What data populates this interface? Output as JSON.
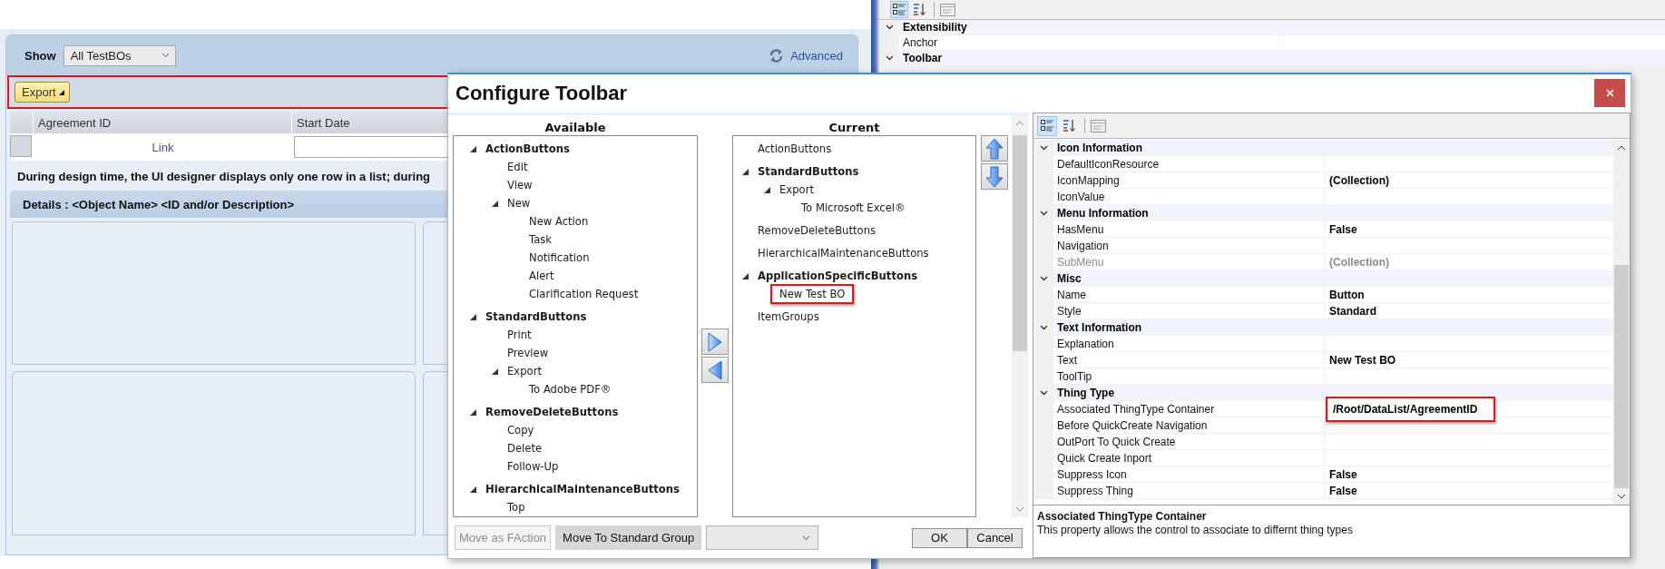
{
  "designer": {
    "filter": {
      "label": "Show",
      "value": "All TestBOs"
    },
    "advanced_link": "Advanced",
    "toolbar": {
      "highlighted": true,
      "buttons": [
        "Export"
      ]
    },
    "table": {
      "columns": [
        "Agreement ID",
        "Start Date"
      ],
      "link": "Link"
    },
    "note": "During design time, the UI designer displays only one row in a list; during",
    "details_title": "Details : <Object Name> <ID and/or Description>"
  },
  "background_properties": {
    "view_buttons": [
      {
        "kind": "categorized",
        "selected": true
      },
      {
        "kind": "alphabetical",
        "selected": false
      }
    ],
    "categories": [
      {
        "name": "Extensibility",
        "expanded": true,
        "rows": [
          {
            "name": "Anchor",
            "disabled": false
          }
        ]
      },
      {
        "name": "Toolbar",
        "expanded": true
      }
    ]
  },
  "dialog": {
    "title": "Configure Toolbar",
    "available": {
      "heading": "Available",
      "tree": [
        {
          "label": "ActionButtons",
          "expanded": true,
          "children": [
            {
              "label": "Edit"
            },
            {
              "label": "View"
            },
            {
              "label": "New",
              "expanded": true,
              "children": [
                {
                  "label": "New Action"
                },
                {
                  "label": "Task"
                },
                {
                  "label": "Notification"
                },
                {
                  "label": "Alert"
                },
                {
                  "label": "Clarification Request"
                }
              ]
            }
          ]
        },
        {
          "label": "StandardButtons",
          "expanded": true,
          "children": [
            {
              "label": "Print"
            },
            {
              "label": "Preview"
            },
            {
              "label": "Export",
              "expanded": true,
              "children": [
                {
                  "label": "To Adobe PDF®"
                }
              ]
            }
          ]
        },
        {
          "label": "RemoveDeleteButtons",
          "expanded": true,
          "children": [
            {
              "label": "Copy"
            },
            {
              "label": "Delete"
            },
            {
              "label": "Follow-Up"
            }
          ]
        },
        {
          "label": "HierarchicalMaintenanceButtons",
          "expanded": true,
          "children": [
            {
              "label": "Top"
            }
          ]
        }
      ]
    },
    "current": {
      "heading": "Current",
      "tree": [
        {
          "label": "ActionButtons"
        },
        {
          "label": "StandardButtons",
          "expanded": true,
          "children": [
            {
              "label": "Export",
              "expanded": true,
              "children": [
                {
                  "label": "To Microsoft Excel®"
                }
              ]
            }
          ]
        },
        {
          "label": "RemoveDeleteButtons"
        },
        {
          "label": "HierarchicalMaintenanceButtons"
        },
        {
          "label": "ApplicationSpecificButtons",
          "expanded": true,
          "children": [
            {
              "label": "New Test BO",
              "highlighted": true
            }
          ]
        },
        {
          "label": "ItemGroups"
        }
      ]
    },
    "bottom_buttons": [
      {
        "label": "Move as FAction",
        "disabled": true
      },
      {
        "label": "Move To Standard Group",
        "disabled": false
      }
    ],
    "dialog_buttons": [
      "OK",
      "Cancel"
    ],
    "properties": {
      "view_buttons": [
        {
          "kind": "categorized",
          "selected": true
        },
        {
          "kind": "alphabetical",
          "selected": false
        }
      ],
      "categories": [
        {
          "name": "Icon Information",
          "expanded": true,
          "rows": [
            {
              "name": "DefaultIconResource",
              "disabled": false
            },
            {
              "name": "IconMapping",
              "value": "(Collection)",
              "disabled": false
            },
            {
              "name": "IconValue",
              "disabled": false
            }
          ]
        },
        {
          "name": "Menu Information",
          "expanded": true,
          "rows": [
            {
              "name": "HasMenu",
              "value": "False",
              "disabled": false
            },
            {
              "name": "Navigation",
              "disabled": false
            },
            {
              "name": "SubMenu",
              "value": "(Collection)",
              "disabled": true
            }
          ]
        },
        {
          "name": "Misc",
          "expanded": true,
          "rows": [
            {
              "name": "Name",
              "value": "Button",
              "disabled": false
            },
            {
              "name": "Style",
              "value": "Standard",
              "disabled": false
            }
          ]
        },
        {
          "name": "Text Information",
          "expanded": true,
          "rows": [
            {
              "name": "Explanation",
              "disabled": false
            },
            {
              "name": "Text",
              "value": "New Test BO",
              "disabled": false
            },
            {
              "name": "ToolTip",
              "disabled": false
            }
          ]
        },
        {
          "name": "Thing Type",
          "expanded": true,
          "rows": [
            {
              "name": "Associated ThingType Container",
              "value": "/Root/DataList/AgreementID",
              "disabled": false,
              "highlighted": true
            },
            {
              "name": "Before QuickCreate Navigation",
              "disabled": false
            },
            {
              "name": "OutPort To Quick Create",
              "disabled": false
            },
            {
              "name": "Quick Create Inport",
              "disabled": false
            },
            {
              "name": "Suppress Icon",
              "value": "False",
              "disabled": false
            },
            {
              "name": "Suppress Thing",
              "value": "False",
              "disabled": false
            }
          ]
        }
      ]
    },
    "description": {
      "title": "Associated ThingType Container",
      "text": "This property allows the control to associate to differnt thing types"
    }
  }
}
